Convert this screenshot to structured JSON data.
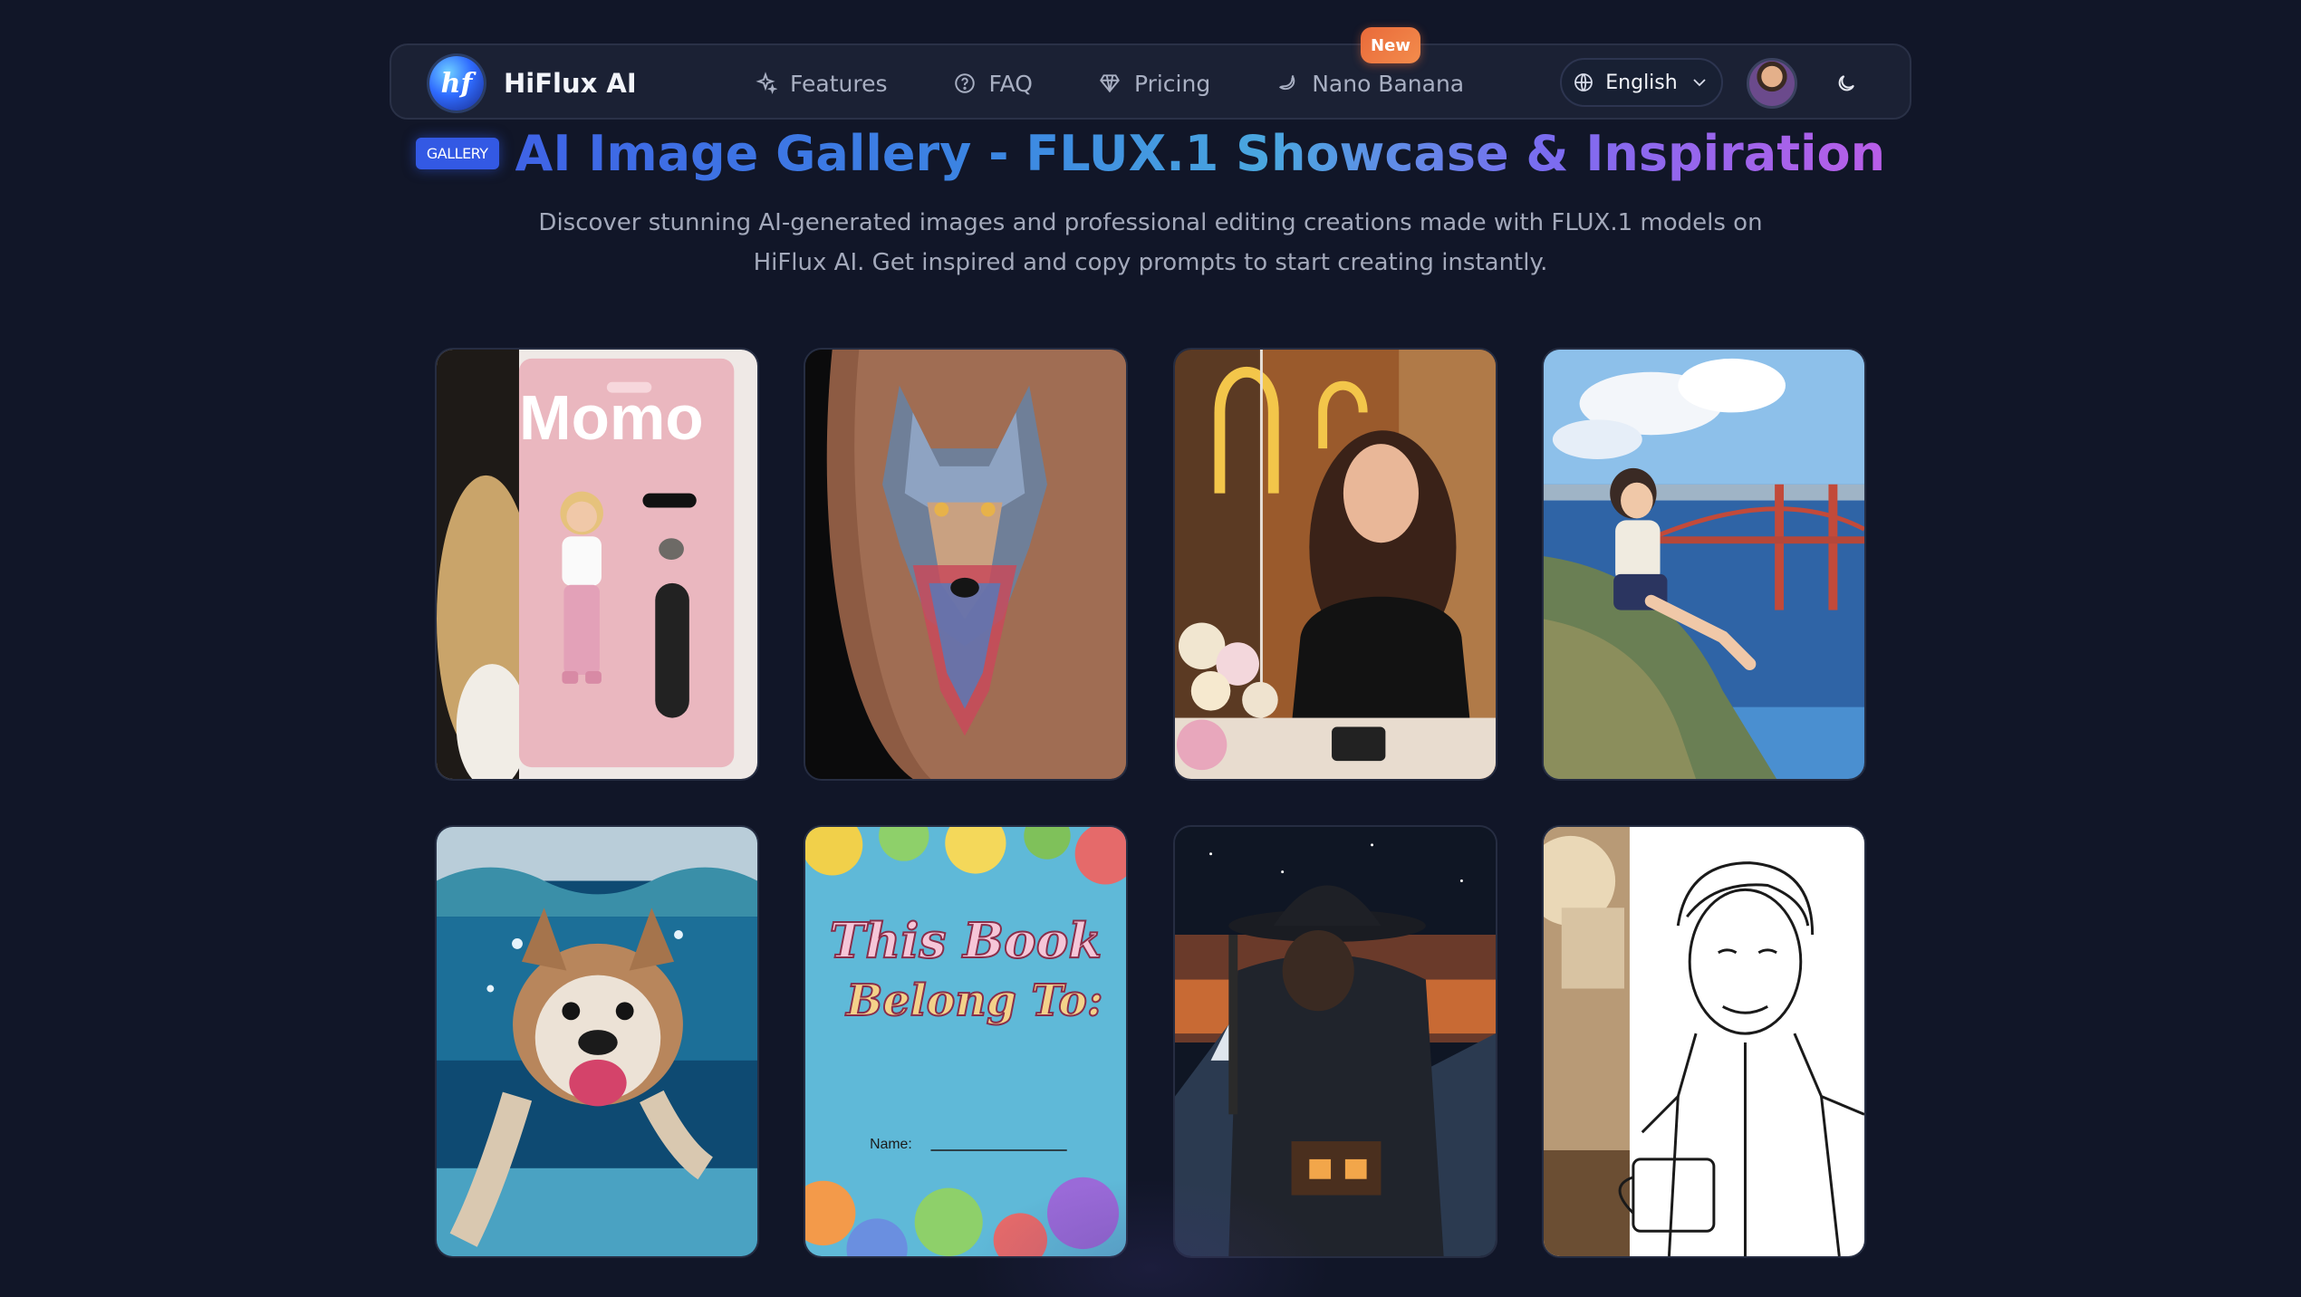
{
  "brand": {
    "name": "HiFlux AI",
    "logo_text": "hf"
  },
  "nav": {
    "links": [
      {
        "label": "Features",
        "icon": "sparkle-icon"
      },
      {
        "label": "FAQ",
        "icon": "question-circle-icon"
      },
      {
        "label": "Pricing",
        "icon": "diamond-icon"
      },
      {
        "label": "Nano Banana",
        "icon": "banana-icon"
      }
    ],
    "new_badge": "New",
    "language": "English"
  },
  "hero": {
    "badge": "GALLERY",
    "title": "AI Image Gallery - FLUX.1 Showcase & Inspiration",
    "subtitle_line1": "Discover stunning AI-generated images and professional editing creations made with FLUX.1 models on",
    "subtitle_line2": "HiFlux AI. Get inspired and copy prompts to start creating instantly."
  },
  "gallery": {
    "items": [
      {
        "subject": "action-figure-doll-packaging",
        "text": "Momo"
      },
      {
        "subject": "wolf-tattoo"
      },
      {
        "subject": "cafe-woman-illustration"
      },
      {
        "subject": "anime-girl-golden-gate"
      },
      {
        "subject": "underwater-dog"
      },
      {
        "subject": "kids-book-cover",
        "title1": "This Book",
        "title2": "Belong To:",
        "name_label": "Name:"
      },
      {
        "subject": "cowboy-double-exposure"
      },
      {
        "subject": "man-coffee-sketch"
      }
    ]
  },
  "colors": {
    "background": "#111628",
    "navbar": "#1b2134",
    "badge": "#3359e4",
    "new_badge": "#e96a3a"
  }
}
